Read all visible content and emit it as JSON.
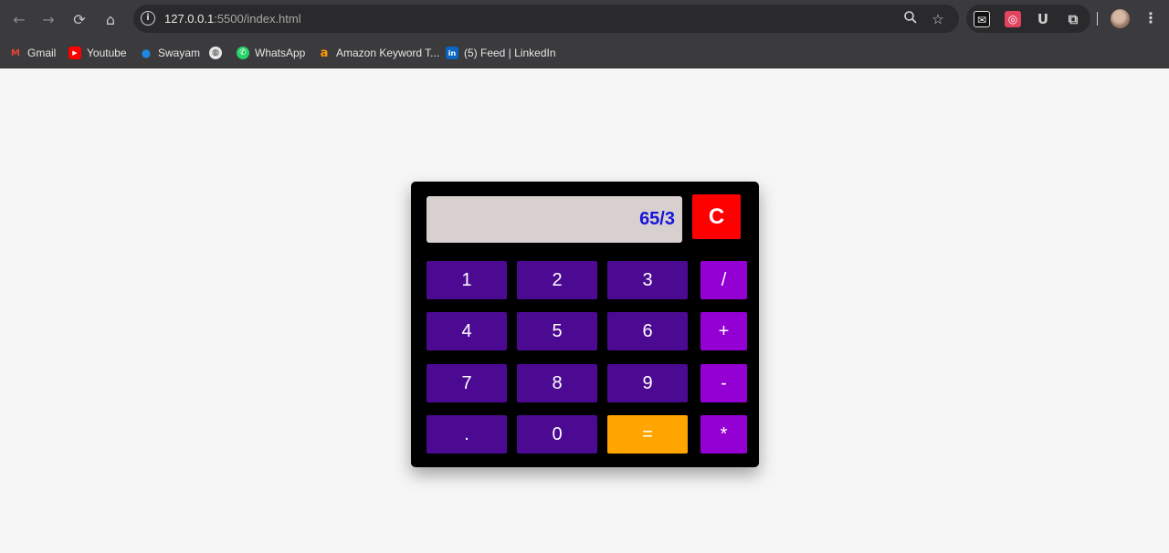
{
  "browser": {
    "url_host": "127.0.0.1",
    "url_path": ":5500/index.html",
    "nav": {
      "back_icon": "←",
      "forward_icon": "→",
      "reload_icon": "⟳",
      "home_icon": "⌂"
    },
    "bookmarks": [
      {
        "label": "Gmail",
        "icon": "M",
        "color": "#ea4335"
      },
      {
        "label": "Youtube",
        "icon": "▶",
        "color": "#ff0000"
      },
      {
        "label": "Swayam",
        "icon": "●",
        "color": "#1e88e5"
      },
      {
        "label": "",
        "icon": "🌐",
        "color": "#3b3a3c"
      },
      {
        "label": "WhatsApp",
        "icon": "✆",
        "color": "#25d366"
      },
      {
        "label": "Amazon Keyword T...",
        "icon": "a",
        "color": "#ff9900"
      },
      {
        "label": "(5) Feed | LinkedIn",
        "icon": "in",
        "color": "#0a66c2"
      }
    ]
  },
  "calculator": {
    "display_value": "65/3",
    "clear_label": "C",
    "keys": [
      {
        "label": "1",
        "type": "digit"
      },
      {
        "label": "2",
        "type": "digit"
      },
      {
        "label": "3",
        "type": "digit"
      },
      {
        "label": "/",
        "type": "op"
      },
      {
        "label": "4",
        "type": "digit"
      },
      {
        "label": "5",
        "type": "digit"
      },
      {
        "label": "6",
        "type": "digit"
      },
      {
        "label": "+",
        "type": "op"
      },
      {
        "label": "7",
        "type": "digit"
      },
      {
        "label": "8",
        "type": "digit"
      },
      {
        "label": "9",
        "type": "digit"
      },
      {
        "label": "-",
        "type": "op"
      },
      {
        "label": ".",
        "type": "digit"
      },
      {
        "label": "0",
        "type": "digit"
      },
      {
        "label": "=",
        "type": "equals"
      },
      {
        "label": "*",
        "type": "op"
      }
    ],
    "colors": {
      "display_text": "#1515d8",
      "clear": "#ff0000",
      "digit": "#4b0a91",
      "operator": "#9400d3",
      "equals": "#ffa500"
    }
  }
}
